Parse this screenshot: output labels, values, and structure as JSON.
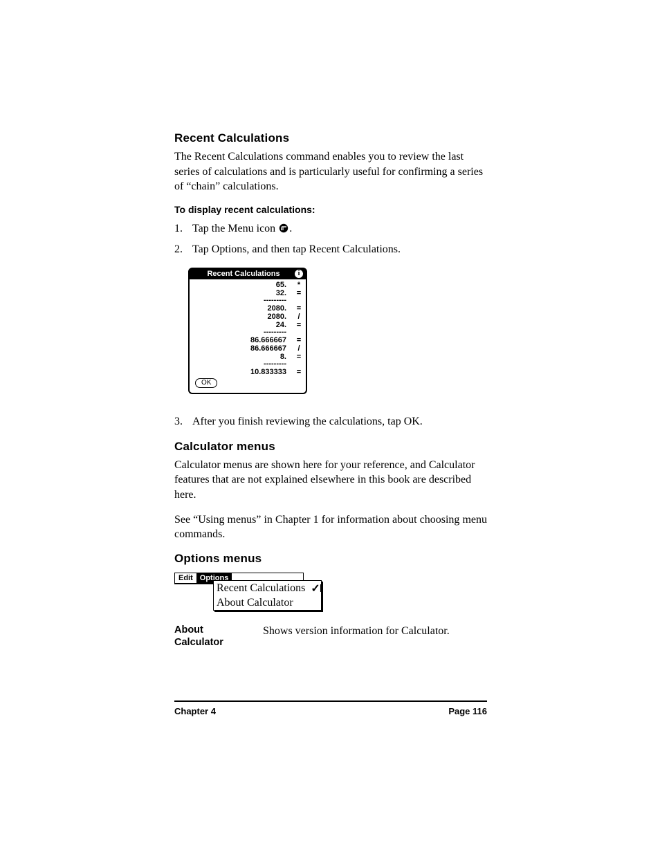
{
  "sections": {
    "recent_title": "Recent Calculations",
    "recent_intro": "The Recent Calculations command enables you to review the last series of calculations and is particularly useful for confirming a series of “chain” calculations.",
    "display_sub": "To display recent calculations:",
    "step1_pre": "Tap the Menu icon",
    "step1_post": ".",
    "step2": "Tap Options, and then tap Recent Calculations.",
    "step3": "After you finish reviewing the calculations, tap OK.",
    "menus_title": "Calculator menus",
    "menus_p1": "Calculator menus are shown here for your reference, and Calculator features that are not explained elsewhere in this book are described here.",
    "menus_p2": "See “Using menus” in Chapter 1 for information about choosing menu commands.",
    "options_title": "Options menus",
    "about_term": "About Calculator",
    "about_desc": "Shows version information for Calculator."
  },
  "nums": {
    "n1": "1.",
    "n2": "2.",
    "n3": "3."
  },
  "dialog": {
    "title": "Recent Calculations",
    "rows": [
      {
        "val": "65.",
        "op": "*"
      },
      {
        "val": "32.",
        "op": "="
      }
    ],
    "rows2": [
      {
        "val": "2080.",
        "op": "="
      },
      {
        "val": "2080.",
        "op": "/"
      },
      {
        "val": "24.",
        "op": "="
      }
    ],
    "rows3": [
      {
        "val": "86.666667",
        "op": "="
      },
      {
        "val": "86.666667",
        "op": "/"
      },
      {
        "val": "8.",
        "op": "="
      }
    ],
    "rows4": [
      {
        "val": "10.833333",
        "op": "="
      }
    ],
    "dash": "---------",
    "ok": "OK"
  },
  "menu": {
    "edit": "Edit",
    "options": "Options",
    "item1": "Recent Calculations",
    "item1_short": "I",
    "item2": "About Calculator"
  },
  "footer": {
    "left": "Chapter 4",
    "right": "Page 116"
  }
}
